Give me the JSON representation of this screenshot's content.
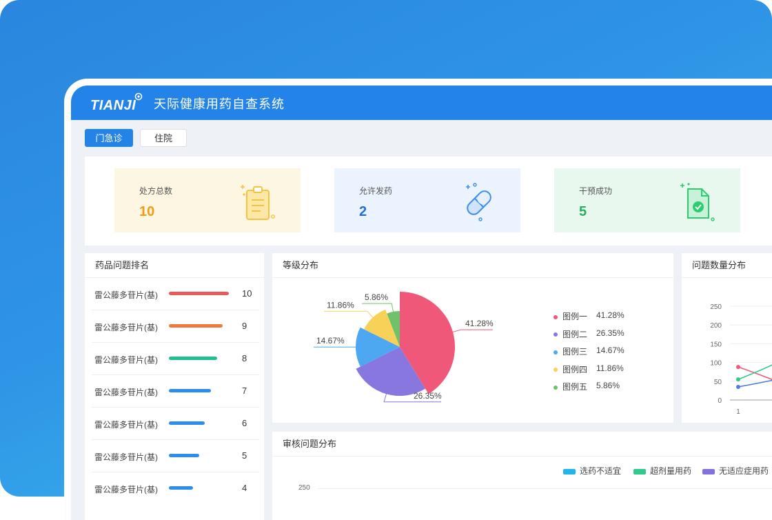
{
  "app": {
    "logo_text": "TIANJI",
    "title": "天际健康用药自查系统"
  },
  "tabs": [
    {
      "label": "门急诊",
      "active": true
    },
    {
      "label": "住院",
      "active": false
    }
  ],
  "stats": [
    {
      "label": "处方总数",
      "value": "10",
      "color": "#f39c12",
      "bg": "#fdf6e3",
      "icon": "clipboard-icon"
    },
    {
      "label": "允许发药",
      "value": "2",
      "color": "#1e6fd9",
      "bg": "#eaf3fe",
      "icon": "pill-icon"
    },
    {
      "label": "干预成功",
      "value": "5",
      "color": "#27ae60",
      "bg": "#e8f8ee",
      "icon": "document-check-icon"
    }
  ],
  "ranking": {
    "title": "药品问题排名",
    "items": [
      {
        "name": "雷公藤多苷片(基)",
        "value": "10",
        "color": "#eb5a57"
      },
      {
        "name": "雷公藤多苷片(基)",
        "value": "9",
        "color": "#f2773d"
      },
      {
        "name": "雷公藤多苷片(基)",
        "value": "8",
        "color": "#1fbf8f"
      },
      {
        "name": "雷公藤多苷片(基)",
        "value": "7",
        "color": "#2d8cf0"
      },
      {
        "name": "雷公藤多苷片(基)",
        "value": "6",
        "color": "#2d8cf0"
      },
      {
        "name": "雷公藤多苷片(基)",
        "value": "5",
        "color": "#2d8cf0"
      },
      {
        "name": "雷公藤多苷片(基)",
        "value": "4",
        "color": "#2d8cf0"
      }
    ]
  },
  "grade": {
    "title": "等级分布",
    "legend": [
      {
        "name": "图例一",
        "pct": "41.28%",
        "color": "#f0587a"
      },
      {
        "name": "图例二",
        "pct": "26.35%",
        "color": "#8777de"
      },
      {
        "name": "图例三",
        "pct": "14.67%",
        "color": "#4da7f1"
      },
      {
        "name": "图例四",
        "pct": "11.86%",
        "color": "#f8d258"
      },
      {
        "name": "图例五",
        "pct": "5.86%",
        "color": "#6fc26a"
      }
    ]
  },
  "count_dist": {
    "title": "问题数量分布",
    "y_ticks": [
      "250",
      "200",
      "150",
      "100",
      "50",
      "0"
    ],
    "x_ticks": [
      "1"
    ]
  },
  "audit": {
    "title": "审核问题分布",
    "legend": [
      {
        "name": "选药不适宜",
        "color": "#22b5ea"
      },
      {
        "name": "超剂量用药",
        "color": "#2ecb8a"
      },
      {
        "name": "无适应症用药",
        "color": "#8470e0"
      }
    ],
    "y_ticks": [
      "250"
    ]
  },
  "chart_data": [
    {
      "type": "pie",
      "title": "等级分布",
      "categories": [
        "图例一",
        "图例二",
        "图例三",
        "图例四",
        "图例五"
      ],
      "values": [
        41.28,
        26.35,
        14.67,
        11.86,
        5.86
      ],
      "labels": [
        "41.28%",
        "26.35%",
        "14.67%",
        "11.86%",
        "5.86%"
      ]
    },
    {
      "type": "line",
      "title": "问题数量分布",
      "x": [
        "1"
      ],
      "ylim": [
        0,
        250
      ],
      "series": [
        {
          "values": [
            88
          ],
          "color": "#f0587a"
        },
        {
          "values": [
            55
          ],
          "color": "#2ecb8a"
        },
        {
          "values": [
            35
          ],
          "color": "#4d7fe0"
        }
      ]
    }
  ]
}
